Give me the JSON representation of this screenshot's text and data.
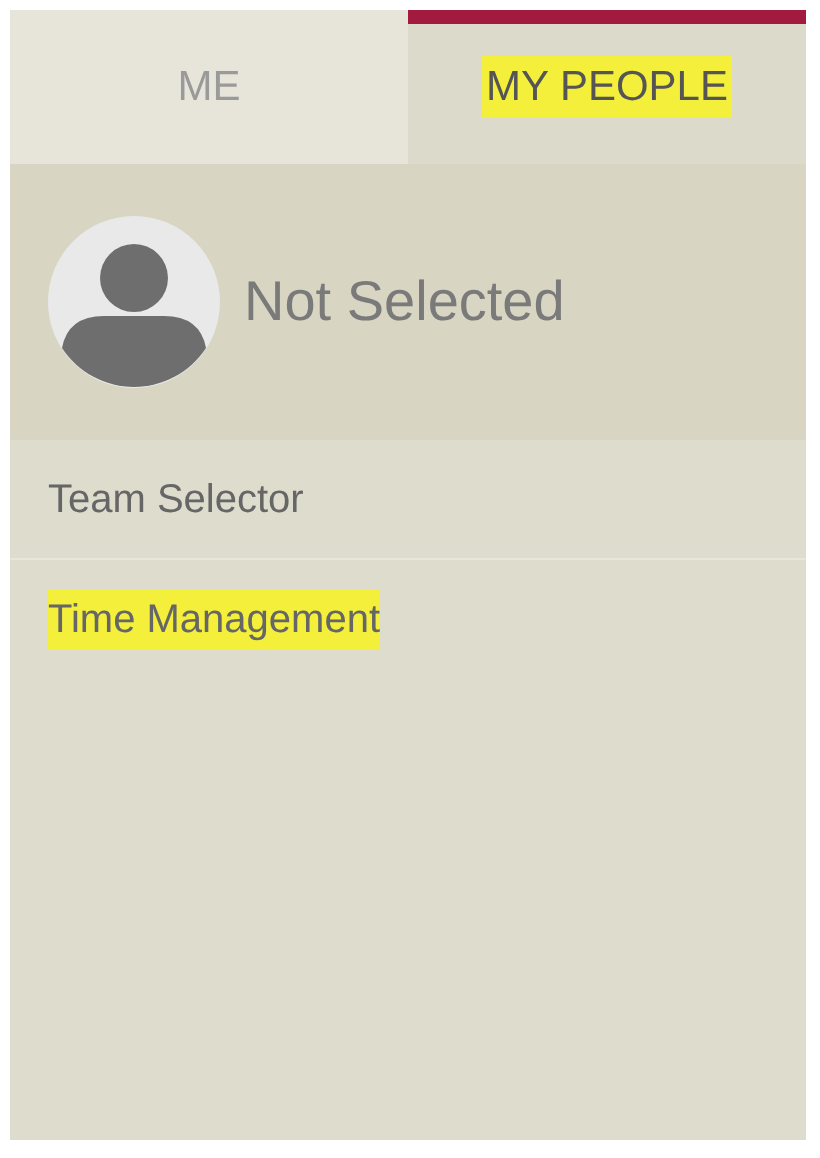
{
  "tabs": [
    {
      "label": "ME",
      "selected": false,
      "highlighted": false
    },
    {
      "label": "MY PEOPLE",
      "selected": true,
      "highlighted": true
    }
  ],
  "profile": {
    "name": "Not Selected"
  },
  "menu": [
    {
      "label": "Team Selector",
      "highlighted": false
    },
    {
      "label": "Time Management",
      "highlighted": true
    }
  ]
}
